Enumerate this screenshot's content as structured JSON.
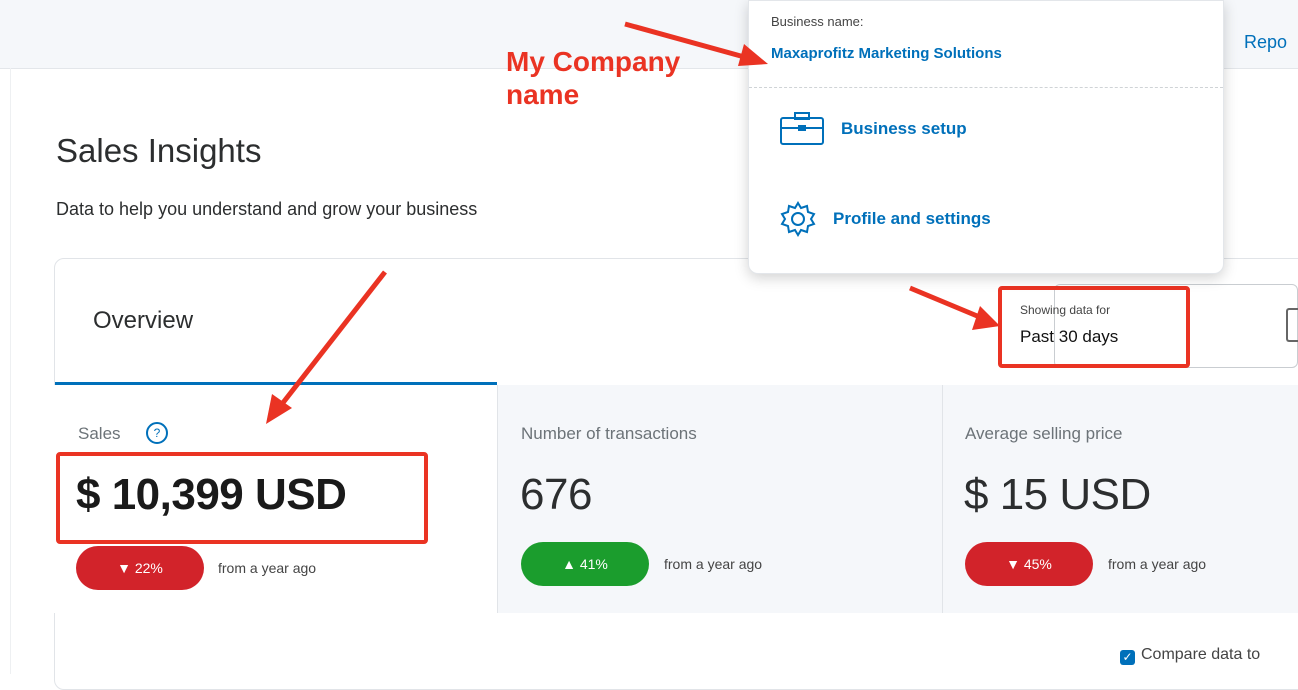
{
  "topbar": {
    "right_link": "Repo"
  },
  "header": {
    "title": "Sales Insights",
    "subtitle": "Data to help you understand and grow your business"
  },
  "tabs": [
    {
      "label": "Overview"
    }
  ],
  "date_filter": {
    "caption": "Showing data for",
    "value": "Past 30 days"
  },
  "metrics": [
    {
      "label": "Sales",
      "value": "$ 10,399 USD",
      "change": "22%",
      "direction": "down",
      "note": "from a year ago"
    },
    {
      "label": "Number of transactions",
      "value": "676",
      "change": "41%",
      "direction": "up",
      "note": "from a year ago"
    },
    {
      "label": "Average selling price",
      "value": "$ 15 USD",
      "change": "45%",
      "direction": "down",
      "note": "from a year ago"
    }
  ],
  "compare": {
    "label": "Compare data to"
  },
  "account_menu": {
    "business_label": "Business name:",
    "business_name": "Maxaprofitz Marketing Solutions",
    "items": [
      {
        "label": "Business setup",
        "icon": "briefcase-icon"
      },
      {
        "label": "Profile and settings",
        "icon": "gear-icon"
      }
    ]
  },
  "annotations": {
    "company_note": "My Company name"
  },
  "colors": {
    "accent": "#0070ba",
    "down": "#d2232a",
    "up": "#1b9d2d",
    "annotation": "#ea3323"
  }
}
